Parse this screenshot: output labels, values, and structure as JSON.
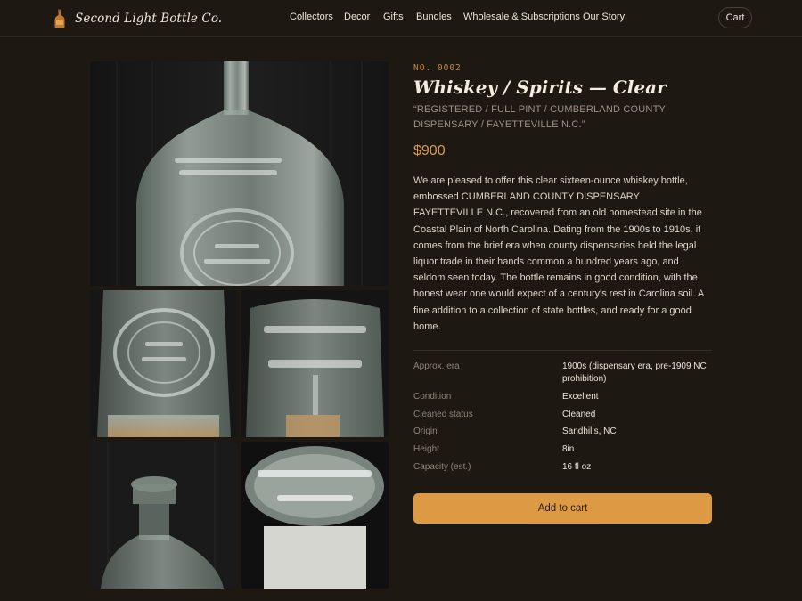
{
  "brand": {
    "name": "Second Light Bottle Co.",
    "logo_icon": "amber-bottle-icon"
  },
  "nav": {
    "items": [
      "Collectors",
      "Decor",
      "Gifts",
      "Bundles",
      "Wholesale & Subscriptions",
      "Our Story"
    ],
    "cart_label": "Cart"
  },
  "gallery": {
    "main_alt": "Embossed clear whiskey bottle, front view",
    "thumbs": [
      "Embossed dispensary seal close-up",
      "Full pint embossing close-up",
      "Bottle neck and lip",
      "Base embossing, Baltimore maker's mark"
    ]
  },
  "product": {
    "item_no": "NO. 0002",
    "title": "Whiskey / Spirits — Clear",
    "embossing": "“REGISTERED / FULL PINT / CUMBERLAND COUNTY DISPENSARY / FAYETTEVILLE N.C.”",
    "price": "$900",
    "description": "We are pleased to offer this clear sixteen-ounce whiskey bottle, embossed CUMBERLAND COUNTY DISPENSARY FAYETTEVILLE N.C., recovered from an old homestead site in the Coastal Plain of North Carolina. Dating from the 1900s to 1910s, it comes from the brief era when county dispensaries held the legal liquor trade in their hands common a hundred years ago, and seldom seen today. The bottle remains in good condition, with the honest wear one would expect of a century's rest in Carolina soil. A fine addition to a collection of state bottles, and ready for a good home.",
    "specs": [
      {
        "label": "Approx. era",
        "value": "1900s (dispensary era, pre-1909 NC prohibition)"
      },
      {
        "label": "Condition",
        "value": "Excellent"
      },
      {
        "label": "Cleaned status",
        "value": "Cleaned"
      },
      {
        "label": "Origin",
        "value": "Sandhills, NC"
      },
      {
        "label": "Height",
        "value": "8in"
      },
      {
        "label": "Capacity (est.)",
        "value": "16 fl oz"
      }
    ],
    "add_to_cart_label": "Add to cart"
  },
  "colors": {
    "background": "#1e1813",
    "accent": "#dd9a45",
    "item_no": "#c58a45",
    "muted_text": "#9d9184"
  }
}
